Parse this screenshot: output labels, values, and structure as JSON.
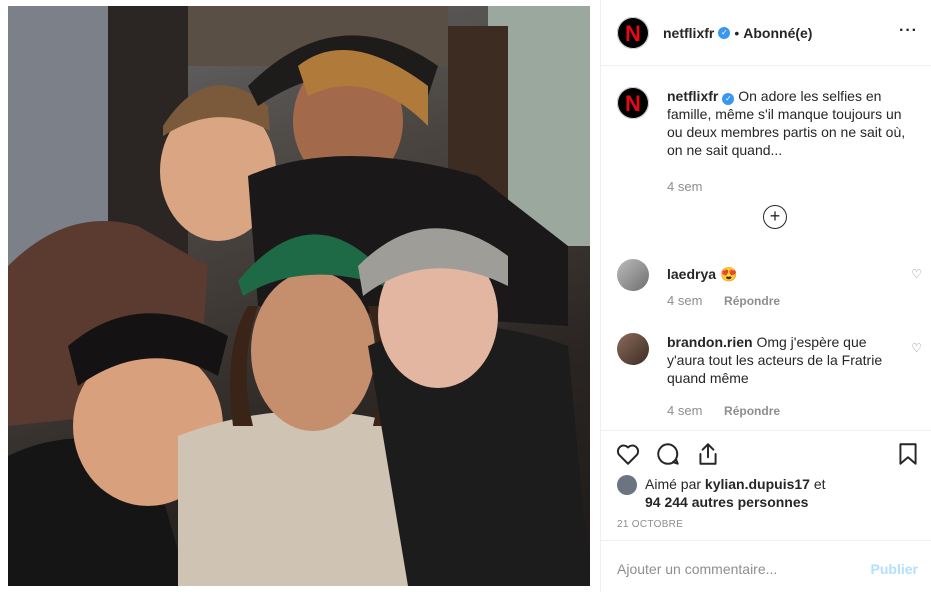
{
  "post": {
    "username": "netflixfr",
    "verified_icon": "verified-badge-icon",
    "separator": "•",
    "follow_status": "Abonné(e)",
    "more_icon": "more-options-icon"
  },
  "caption": {
    "username": "netflixfr",
    "text": "On adore les selfies en famille, même s'il manque toujours un ou deux membres partis on ne sait où, on ne sait quand...",
    "time": "4 sem",
    "load_more_icon": "plus-circle-icon"
  },
  "comments": [
    {
      "username": "laedrya",
      "text": "😍",
      "time": "4 sem",
      "reply": "Répondre"
    },
    {
      "username": "brandon.rien",
      "text": "Omg j'espère que y'aura tout les acteurs de la Fratrie quand même",
      "time": "4 sem",
      "reply": "Répondre"
    }
  ],
  "likes": {
    "prefix": "Aimé par",
    "user": "kylian.dupuis17",
    "conj": "et",
    "others": "94 244 autres personnes"
  },
  "date": "21 OCTOBRE",
  "add_comment": {
    "placeholder": "Ajouter un commentaire...",
    "publish": "Publier"
  },
  "colors": {
    "accent": "#3897f0",
    "publish_disabled": "#b2dffc",
    "netflix_red": "#e50914"
  }
}
